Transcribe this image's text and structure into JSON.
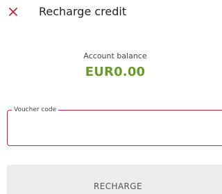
{
  "header": {
    "title": "Recharge credit",
    "close_icon": "close-icon"
  },
  "balance": {
    "label": "Account balance",
    "value": "EUR0.00",
    "value_color": "#6a9a2a"
  },
  "voucher": {
    "label": "Voucher code",
    "value": "",
    "accent_color": "#c4223a"
  },
  "actions": {
    "recharge_label": "RECHARGE"
  }
}
